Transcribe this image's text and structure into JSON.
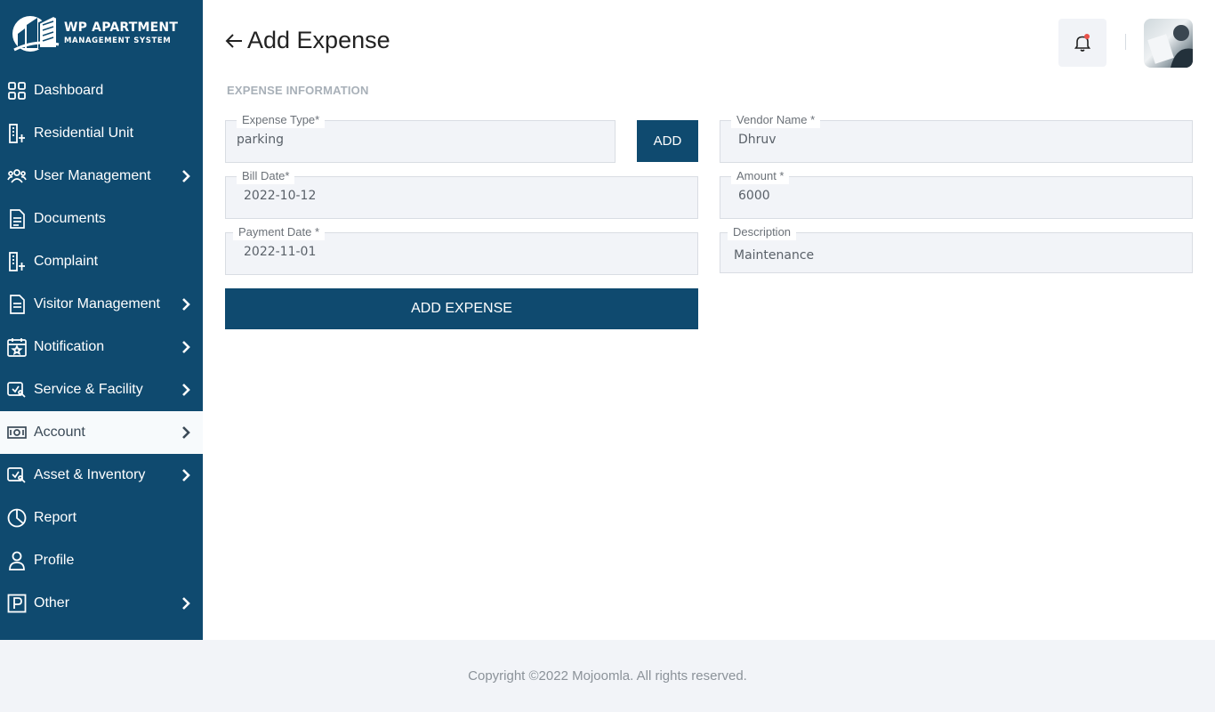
{
  "brand": {
    "title": "WP APARTMENT",
    "subtitle": "MANAGEMENT SYSTEM"
  },
  "sidebar": {
    "items": [
      {
        "label": "Dashboard",
        "icon": "dashboard-grid-icon",
        "has_submenu": false
      },
      {
        "label": "Residential Unit",
        "icon": "building-icon",
        "has_submenu": false
      },
      {
        "label": "User Management",
        "icon": "users-icon",
        "has_submenu": true
      },
      {
        "label": "Documents",
        "icon": "document-icon",
        "has_submenu": false
      },
      {
        "label": "Complaint",
        "icon": "building-icon",
        "has_submenu": false
      },
      {
        "label": "Visitor Management",
        "icon": "clipboard-icon",
        "has_submenu": true
      },
      {
        "label": "Notification",
        "icon": "calendar-star-icon",
        "has_submenu": true
      },
      {
        "label": "Service & Facility",
        "icon": "service-icon",
        "has_submenu": true
      },
      {
        "label": "Account",
        "icon": "money-icon",
        "has_submenu": true,
        "active": true
      },
      {
        "label": "Asset & Inventory",
        "icon": "service-icon",
        "has_submenu": true
      },
      {
        "label": "Report",
        "icon": "pie-chart-icon",
        "has_submenu": false
      },
      {
        "label": "Profile",
        "icon": "user-icon",
        "has_submenu": false
      },
      {
        "label": "Other",
        "icon": "parking-icon",
        "has_submenu": true
      }
    ]
  },
  "header": {
    "title": "Add Expense"
  },
  "form": {
    "section_label": "EXPENSE INFORMATION",
    "expense_type": {
      "label": "Expense Type*",
      "value": "parking"
    },
    "add_button": "ADD",
    "vendor_name": {
      "label": "Vendor Name *",
      "value": "Dhruv"
    },
    "bill_date": {
      "label": "Bill Date*",
      "value": "2022-10-12"
    },
    "amount": {
      "label": "Amount *",
      "value": "6000"
    },
    "payment_date": {
      "label": "Payment Date *",
      "value": "2022-11-01"
    },
    "description": {
      "label": "Description",
      "value": "Maintenance"
    },
    "submit_button": "ADD EXPENSE"
  },
  "footer": {
    "copyright": "Copyright ©2022 Mojoomla. All rights reserved."
  },
  "colors": {
    "primary": "#0f4a6f",
    "field_bg": "#f2f4f8",
    "notification_dot": "#e9524a"
  }
}
